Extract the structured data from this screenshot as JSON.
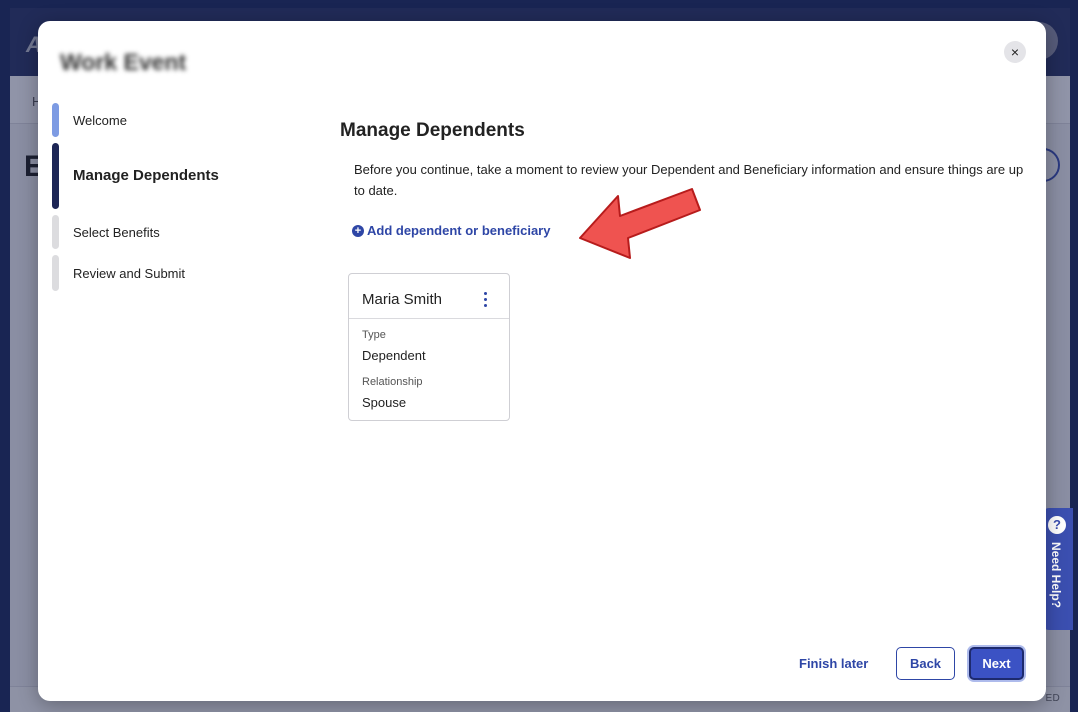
{
  "background": {
    "logo": "A",
    "sub_letter": "H",
    "big_letter": "E",
    "footer_copyright": "ED",
    "need_help": "Need Help?"
  },
  "modal": {
    "title": "Work Event",
    "close": "×"
  },
  "stepper": {
    "steps": [
      {
        "label": "Welcome",
        "state": "completed"
      },
      {
        "label": "Manage Dependents",
        "state": "current"
      },
      {
        "label": "Select Benefits",
        "state": "upcoming"
      },
      {
        "label": "Review and Submit",
        "state": "upcoming"
      }
    ]
  },
  "content": {
    "title": "Manage Dependents",
    "description": "Before you continue, take a moment to review your Dependent and Beneficiary information and ensure things are up to date.",
    "add_link": "Add dependent or beneficiary"
  },
  "dependents": [
    {
      "name": "Maria Smith",
      "type_label": "Type",
      "type_value": "Dependent",
      "relationship_label": "Relationship",
      "relationship_value": "Spouse"
    }
  ],
  "footer": {
    "finish_later": "Finish later",
    "back": "Back",
    "next": "Next"
  },
  "colors": {
    "accent": "#2e46a6",
    "primary_button": "#3b52c4",
    "step_current": "#1d2656",
    "step_completed": "#7d9be3",
    "annotation_arrow": "#ef5350"
  }
}
